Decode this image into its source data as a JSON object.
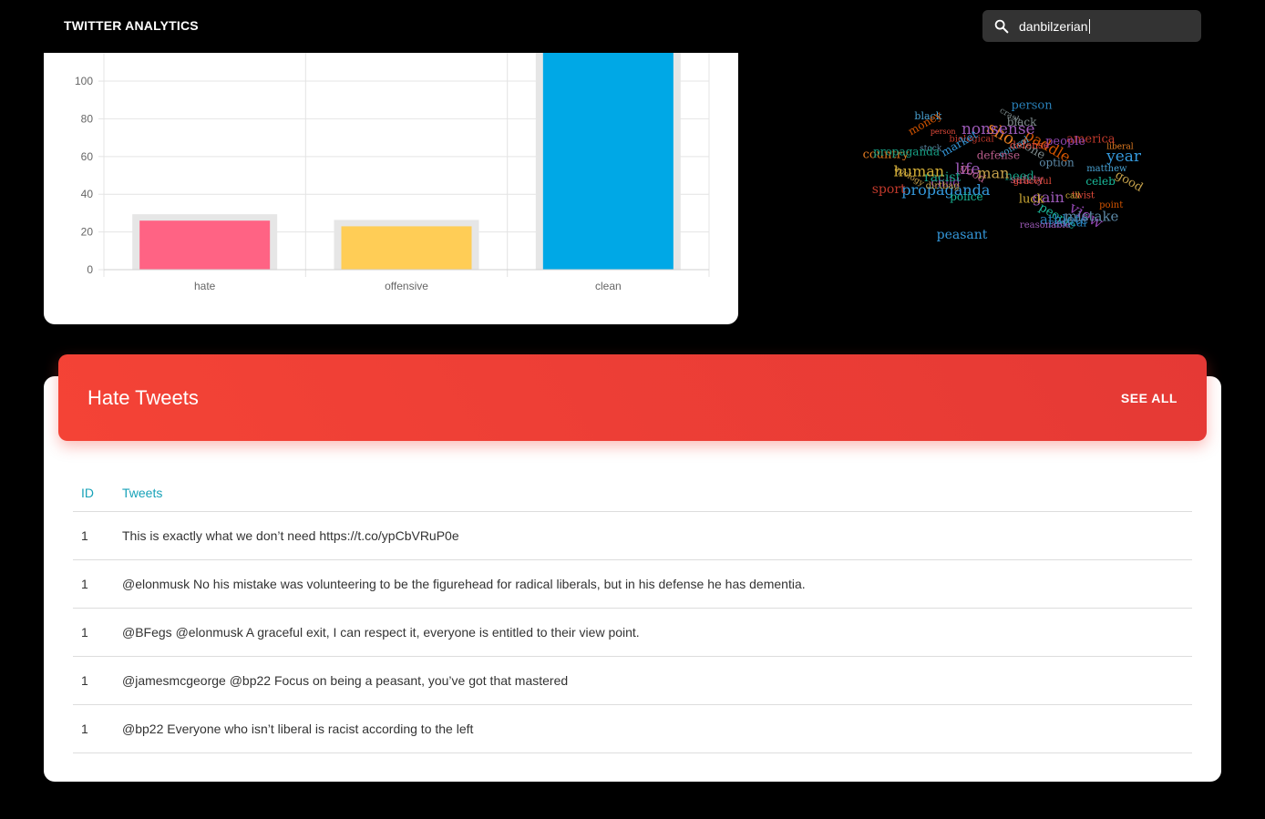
{
  "app": {
    "title": "TWITTER ANALYTICS"
  },
  "search": {
    "value": "danbilzerian",
    "icon": "search-icon"
  },
  "chart_data": {
    "type": "bar",
    "categories": [
      "hate",
      "offensive",
      "clean"
    ],
    "values": [
      26,
      23,
      120
    ],
    "ylim": [
      0,
      115
    ],
    "yticks": [
      0,
      20,
      40,
      60,
      80,
      100
    ],
    "colors": [
      "#ff6384",
      "#ffcd56",
      "#00a8e6"
    ],
    "grid": true,
    "legend": "none"
  },
  "wordcloud": {
    "words": [
      "apology",
      "life",
      "propaganda",
      "twist",
      "people",
      "liberal",
      "option",
      "biological",
      "child",
      "radical",
      "point",
      "racist",
      "crash",
      "safety",
      "black",
      "human",
      "dirtbag",
      "gain",
      "year",
      "person",
      "police",
      "sho",
      "stock",
      "sport",
      "view",
      "athlete",
      "paddle",
      "need",
      "zone",
      "good",
      "control",
      "call",
      "man",
      "nonsense",
      "market",
      "graceful",
      "celeb",
      "country",
      "mistake",
      "america",
      "people",
      "person",
      "money",
      "propaganda",
      "black",
      "defense",
      "matthew",
      "luck",
      "good",
      "reasonable",
      "peasant",
      "defense"
    ]
  },
  "hate_tweets": {
    "title": "Hate Tweets",
    "see_all": "SEE ALL",
    "columns": [
      "ID",
      "Tweets"
    ],
    "rows": [
      {
        "id": "1",
        "text": "This is exactly what we don’t need https://t.co/ypCbVRuP0e"
      },
      {
        "id": "1",
        "text": "@elonmusk No his mistake was volunteering to be the figurehead for radical liberals, but in his defense he has dementia."
      },
      {
        "id": "1",
        "text": "@BFegs @elonmusk A graceful exit, I can respect it, everyone is entitled to their view point."
      },
      {
        "id": "1",
        "text": "@jamesmcgeorge @bp22 Focus on being a peasant, you’ve got that mastered"
      },
      {
        "id": "1",
        "text": "@bp22 Everyone who isn’t liberal is racist according to the left"
      }
    ]
  }
}
